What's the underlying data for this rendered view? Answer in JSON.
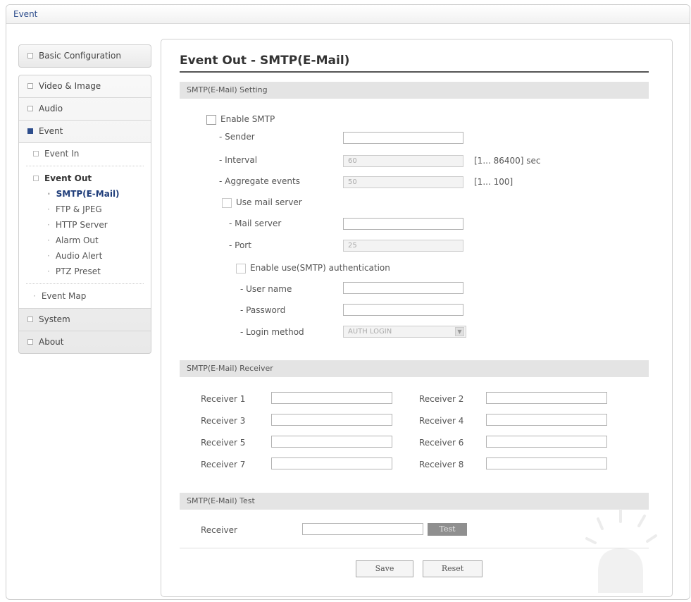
{
  "window": {
    "title": "Event"
  },
  "sidebar": {
    "basic_configuration": "Basic Configuration",
    "video_image": "Video & Image",
    "audio": "Audio",
    "event": "Event",
    "event_in": "Event In",
    "event_out": "Event Out",
    "event_out_items": [
      "SMTP(E-Mail)",
      "FTP & JPEG",
      "HTTP Server",
      "Alarm Out",
      "Audio Alert",
      "PTZ Preset"
    ],
    "event_map": "Event Map",
    "system": "System",
    "about": "About"
  },
  "page": {
    "title": "Event Out - SMTP(E-Mail)"
  },
  "setting": {
    "header": "SMTP(E-Mail) Setting",
    "enable_smtp": "Enable SMTP",
    "sender_label": "- Sender",
    "sender_value": "",
    "interval_label": "- Interval",
    "interval_value": "60",
    "interval_range": "[1... 86400] sec",
    "aggregate_label": "- Aggregate events",
    "aggregate_value": "50",
    "aggregate_range": "[1... 100]",
    "use_mail_server": "Use mail server",
    "mail_server_label": "- Mail server",
    "mail_server_value": "",
    "port_label": "- Port",
    "port_value": "25",
    "enable_auth": "Enable use(SMTP) authentication",
    "user_name_label": "- User name",
    "password_label": "- Password",
    "login_method_label": "- Login method",
    "login_method_value": "AUTH LOGIN"
  },
  "receiver": {
    "header": "SMTP(E-Mail) Receiver",
    "labels": [
      "Receiver 1",
      "Receiver 2",
      "Receiver 3",
      "Receiver 4",
      "Receiver 5",
      "Receiver 6",
      "Receiver 7",
      "Receiver 8"
    ]
  },
  "test": {
    "header": "SMTP(E-Mail) Test",
    "receiver_label": "Receiver",
    "test_button": "Test"
  },
  "actions": {
    "save": "Save",
    "reset": "Reset"
  },
  "colors": {
    "accent": "#2d4d8c",
    "section_bg": "#e4e4e4"
  }
}
